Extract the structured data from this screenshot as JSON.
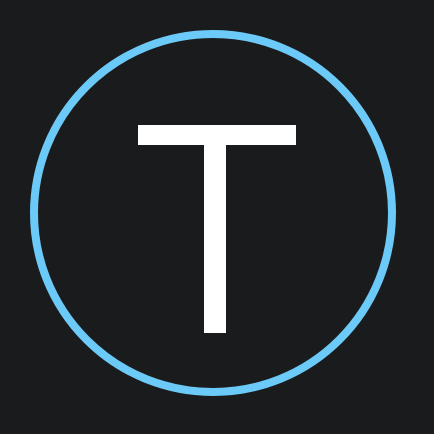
{
  "icon": {
    "name": "t-logo-icon",
    "letter": "T",
    "colors": {
      "background": "#1a1b1c",
      "ring": "#6ccaf8",
      "letter": "#ffffff"
    }
  }
}
